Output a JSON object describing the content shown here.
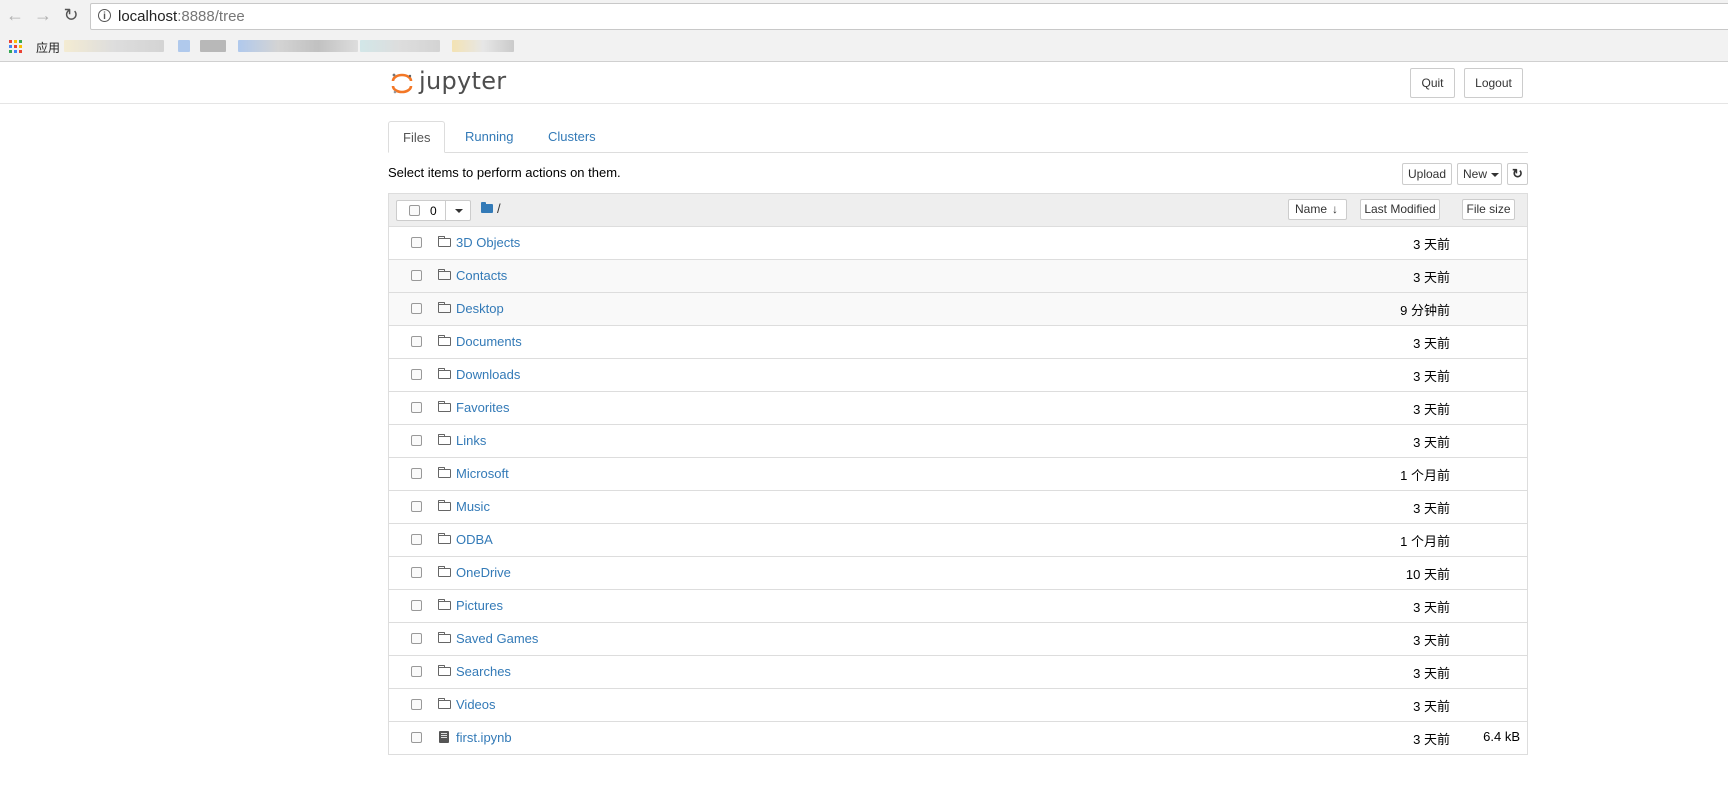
{
  "browser": {
    "url_host": "localhost",
    "url_rest": ":8888/tree",
    "bookmarks_label": "应用"
  },
  "header": {
    "logo_text": "jupyter",
    "quit_label": "Quit",
    "logout_label": "Logout"
  },
  "tabs": [
    {
      "label": "Files",
      "active": true
    },
    {
      "label": "Running",
      "active": false
    },
    {
      "label": "Clusters",
      "active": false
    }
  ],
  "toolbar": {
    "instructions": "Select items to perform actions on them.",
    "upload_label": "Upload",
    "new_label": "New"
  },
  "list_header": {
    "selected_count": "0",
    "breadcrumb": "/",
    "sort_name_label": "Name",
    "sort_modified_label": "Last Modified",
    "sort_size_label": "File size"
  },
  "items": [
    {
      "name": "3D Objects",
      "type": "folder",
      "modified": "3 天前",
      "size": ""
    },
    {
      "name": "Contacts",
      "type": "folder",
      "modified": "3 天前",
      "size": ""
    },
    {
      "name": "Desktop",
      "type": "folder",
      "modified": "9 分钟前",
      "size": ""
    },
    {
      "name": "Documents",
      "type": "folder",
      "modified": "3 天前",
      "size": ""
    },
    {
      "name": "Downloads",
      "type": "folder",
      "modified": "3 天前",
      "size": ""
    },
    {
      "name": "Favorites",
      "type": "folder",
      "modified": "3 天前",
      "size": ""
    },
    {
      "name": "Links",
      "type": "folder",
      "modified": "3 天前",
      "size": ""
    },
    {
      "name": "Microsoft",
      "type": "folder",
      "modified": "1 个月前",
      "size": ""
    },
    {
      "name": "Music",
      "type": "folder",
      "modified": "3 天前",
      "size": ""
    },
    {
      "name": "ODBA",
      "type": "folder",
      "modified": "1 个月前",
      "size": ""
    },
    {
      "name": "OneDrive",
      "type": "folder",
      "modified": "10 天前",
      "size": ""
    },
    {
      "name": "Pictures",
      "type": "folder",
      "modified": "3 天前",
      "size": ""
    },
    {
      "name": "Saved Games",
      "type": "folder",
      "modified": "3 天前",
      "size": ""
    },
    {
      "name": "Searches",
      "type": "folder",
      "modified": "3 天前",
      "size": ""
    },
    {
      "name": "Videos",
      "type": "folder",
      "modified": "3 天前",
      "size": ""
    },
    {
      "name": "first.ipynb",
      "type": "notebook",
      "modified": "3 天前",
      "size": "6.4 kB"
    }
  ]
}
